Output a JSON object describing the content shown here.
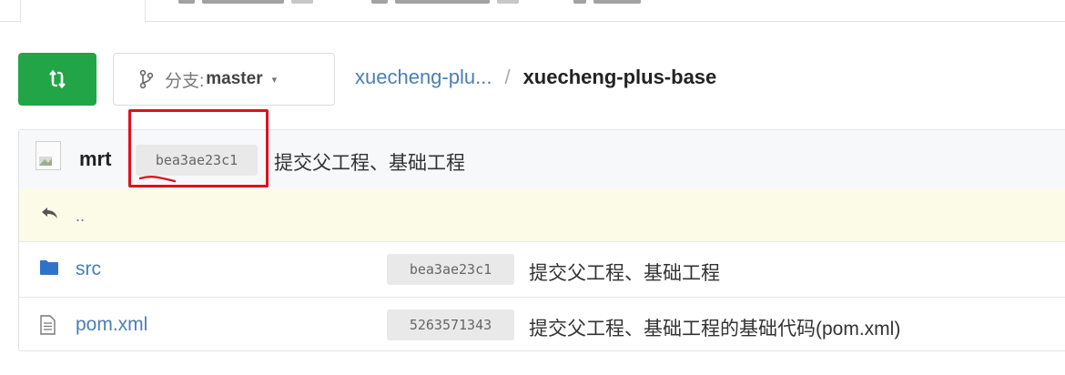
{
  "toolbar": {
    "compare_icon": "compare-arrows-icon",
    "branch": {
      "icon": "git-branch-icon",
      "prefix": "分支:",
      "name": "master",
      "caret": "▾"
    },
    "breadcrumb": {
      "parent": "xuecheng-plu...",
      "separator": "/",
      "current": "xuecheng-plus-base"
    }
  },
  "latest_commit": {
    "author": "mrt",
    "sha": "bea3ae23c1",
    "message": "提交父工程、基础工程"
  },
  "parent_dir": {
    "label": ".."
  },
  "files": [
    {
      "icon": "folder-icon",
      "name": "src",
      "sha": "bea3ae23c1",
      "message": "提交父工程、基础工程"
    },
    {
      "icon": "file-icon",
      "name": "pom.xml",
      "sha": "5263571343",
      "message": "提交父工程、基础工程的基础代码(pom.xml)"
    }
  ],
  "colors": {
    "accent_green": "#21a547",
    "link_blue": "#4a7fb5",
    "annotation_red": "#e0101c",
    "parent_row_bg": "#fcfbe8"
  }
}
